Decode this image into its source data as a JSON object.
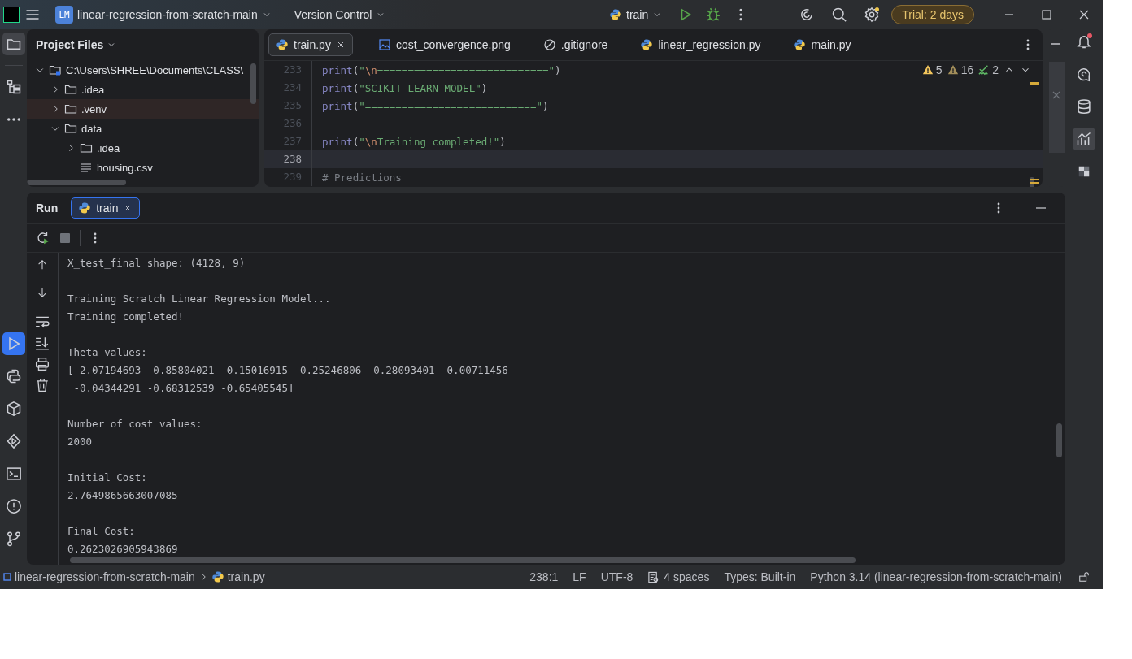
{
  "title_bar": {
    "badge": "LM",
    "project": "linear-regression-from-scratch-main",
    "vcs": "Version Control",
    "run_config": "train",
    "trial": "Trial: 2 days"
  },
  "left_toolbar": {
    "top": [
      {
        "kind": "folder",
        "selected": true
      },
      {
        "kind": "structure",
        "selected": false
      },
      {
        "kind": "more",
        "selected": false
      }
    ],
    "bottom": [
      {
        "kind": "run",
        "selected": true
      },
      {
        "kind": "python",
        "selected": false
      },
      {
        "kind": "packages",
        "selected": false
      },
      {
        "kind": "services",
        "selected": false
      },
      {
        "kind": "terminal",
        "selected": false
      },
      {
        "kind": "problems",
        "selected": false
      },
      {
        "kind": "git",
        "selected": false
      }
    ]
  },
  "project_panel": {
    "title": "Project Files",
    "tree": [
      {
        "label": "C:\\Users\\SHREE\\Documents\\CLASS\\",
        "kind": "root",
        "expanded": true,
        "selected": false,
        "children": [
          {
            "label": ".idea",
            "kind": "folder",
            "expanded": false,
            "selected": false
          },
          {
            "label": ".venv",
            "kind": "folder",
            "expanded": false,
            "selected": true
          },
          {
            "label": "data",
            "kind": "folder",
            "expanded": true,
            "selected": false,
            "children": [
              {
                "label": ".idea",
                "kind": "folder",
                "expanded": false,
                "selected": false
              },
              {
                "label": "housing.csv",
                "kind": "file",
                "selected": false
              }
            ]
          }
        ]
      }
    ]
  },
  "editor": {
    "tabs": [
      {
        "label": "train.py",
        "kind": "python",
        "selected": true
      },
      {
        "label": "cost_convergence.png",
        "kind": "image",
        "selected": false
      },
      {
        "label": ".gitignore",
        "kind": "ignored",
        "selected": false
      },
      {
        "label": "linear_regression.py",
        "kind": "python",
        "selected": false
      },
      {
        "label": "main.py",
        "kind": "python",
        "selected": false
      }
    ],
    "inspections": {
      "errors": "5",
      "warnings": "16",
      "typos": "2"
    },
    "lines": [
      {
        "number": "233",
        "current": false,
        "tokens": [
          {
            "kind": "builtin",
            "text": "print"
          },
          {
            "kind": "plain",
            "text": "("
          },
          {
            "kind": "string",
            "text": "\""
          },
          {
            "kind": "escape",
            "text": "\\n"
          },
          {
            "kind": "string",
            "text": "============================\""
          },
          {
            "kind": "plain",
            "text": ")"
          }
        ]
      },
      {
        "number": "234",
        "current": false,
        "tokens": [
          {
            "kind": "builtin",
            "text": "print"
          },
          {
            "kind": "plain",
            "text": "("
          },
          {
            "kind": "string",
            "text": "\"SCIKIT-LEARN MODEL\""
          },
          {
            "kind": "plain",
            "text": ")"
          }
        ]
      },
      {
        "number": "235",
        "current": false,
        "tokens": [
          {
            "kind": "builtin",
            "text": "print"
          },
          {
            "kind": "plain",
            "text": "("
          },
          {
            "kind": "string",
            "text": "\"============================\""
          },
          {
            "kind": "plain",
            "text": ")"
          }
        ]
      },
      {
        "number": "236",
        "current": false
      },
      {
        "number": "237",
        "current": false,
        "tokens": [
          {
            "kind": "builtin",
            "text": "print"
          },
          {
            "kind": "plain",
            "text": "("
          },
          {
            "kind": "string",
            "text": "\""
          },
          {
            "kind": "escape",
            "text": "\\n"
          },
          {
            "kind": "string",
            "text": "Training completed!\""
          },
          {
            "kind": "plain",
            "text": ")"
          }
        ]
      },
      {
        "number": "238",
        "current": true
      },
      {
        "number": "239",
        "current": false,
        "tokens": [
          {
            "kind": "comment",
            "text": "# Predictions"
          }
        ]
      }
    ]
  },
  "right_toolbar": [
    {
      "kind": "bell",
      "selected": false
    },
    {
      "kind": "ai",
      "selected": false
    },
    {
      "kind": "database",
      "selected": false
    },
    {
      "kind": "chart",
      "selected": true
    },
    {
      "kind": "plugin",
      "selected": false
    }
  ],
  "run_panel": {
    "title": "Run",
    "tab": "train",
    "output": [
      [
        "X_test_final shape: (4128, 9)"
      ],
      [
        "Training Scratch Linear Regression Model...",
        "Training completed!"
      ],
      [
        "Theta values:",
        "[ 2.07194693  0.85804021  0.15016915 -0.25246806  0.28093401  0.00711456",
        " -0.04344291 -0.68312539 -0.65405545]"
      ],
      [
        "Number of cost values:",
        "2000"
      ],
      [
        "Initial Cost:",
        "2.7649865663007085"
      ],
      [
        "Final Cost:",
        "0.2623026905943869"
      ]
    ]
  },
  "status_bar": {
    "breadcrumbs": [
      "linear-regression-from-scratch-main",
      "train.py"
    ],
    "items": [
      "238:1",
      "LF",
      "UTF-8",
      "4 spaces",
      "Types: Built-in",
      "Python 3.14 (linear-regression-from-scratch-main)"
    ]
  }
}
